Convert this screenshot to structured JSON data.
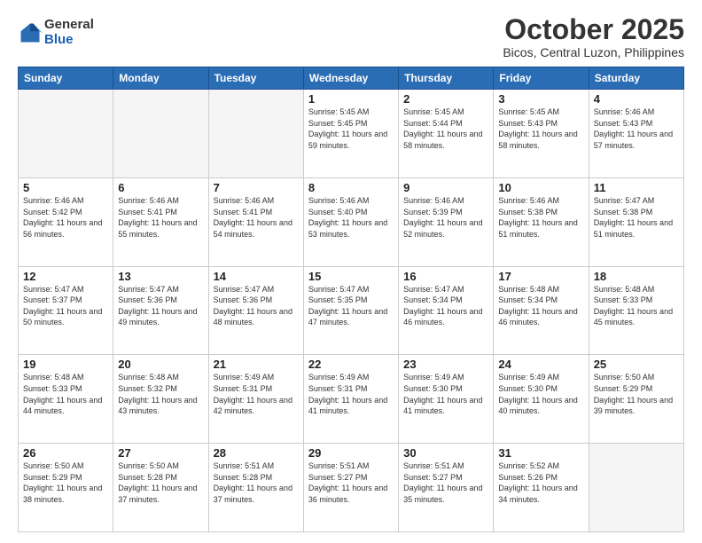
{
  "logo": {
    "general": "General",
    "blue": "Blue"
  },
  "header": {
    "month": "October 2025",
    "location": "Bicos, Central Luzon, Philippines"
  },
  "weekdays": [
    "Sunday",
    "Monday",
    "Tuesday",
    "Wednesday",
    "Thursday",
    "Friday",
    "Saturday"
  ],
  "weeks": [
    [
      {
        "day": "",
        "sunrise": "",
        "sunset": "",
        "daylight": "",
        "empty": true
      },
      {
        "day": "",
        "sunrise": "",
        "sunset": "",
        "daylight": "",
        "empty": true
      },
      {
        "day": "",
        "sunrise": "",
        "sunset": "",
        "daylight": "",
        "empty": true
      },
      {
        "day": "1",
        "sunrise": "Sunrise: 5:45 AM",
        "sunset": "Sunset: 5:45 PM",
        "daylight": "Daylight: 11 hours and 59 minutes."
      },
      {
        "day": "2",
        "sunrise": "Sunrise: 5:45 AM",
        "sunset": "Sunset: 5:44 PM",
        "daylight": "Daylight: 11 hours and 58 minutes."
      },
      {
        "day": "3",
        "sunrise": "Sunrise: 5:45 AM",
        "sunset": "Sunset: 5:43 PM",
        "daylight": "Daylight: 11 hours and 58 minutes."
      },
      {
        "day": "4",
        "sunrise": "Sunrise: 5:46 AM",
        "sunset": "Sunset: 5:43 PM",
        "daylight": "Daylight: 11 hours and 57 minutes."
      }
    ],
    [
      {
        "day": "5",
        "sunrise": "Sunrise: 5:46 AM",
        "sunset": "Sunset: 5:42 PM",
        "daylight": "Daylight: 11 hours and 56 minutes."
      },
      {
        "day": "6",
        "sunrise": "Sunrise: 5:46 AM",
        "sunset": "Sunset: 5:41 PM",
        "daylight": "Daylight: 11 hours and 55 minutes."
      },
      {
        "day": "7",
        "sunrise": "Sunrise: 5:46 AM",
        "sunset": "Sunset: 5:41 PM",
        "daylight": "Daylight: 11 hours and 54 minutes."
      },
      {
        "day": "8",
        "sunrise": "Sunrise: 5:46 AM",
        "sunset": "Sunset: 5:40 PM",
        "daylight": "Daylight: 11 hours and 53 minutes."
      },
      {
        "day": "9",
        "sunrise": "Sunrise: 5:46 AM",
        "sunset": "Sunset: 5:39 PM",
        "daylight": "Daylight: 11 hours and 52 minutes."
      },
      {
        "day": "10",
        "sunrise": "Sunrise: 5:46 AM",
        "sunset": "Sunset: 5:38 PM",
        "daylight": "Daylight: 11 hours and 51 minutes."
      },
      {
        "day": "11",
        "sunrise": "Sunrise: 5:47 AM",
        "sunset": "Sunset: 5:38 PM",
        "daylight": "Daylight: 11 hours and 51 minutes."
      }
    ],
    [
      {
        "day": "12",
        "sunrise": "Sunrise: 5:47 AM",
        "sunset": "Sunset: 5:37 PM",
        "daylight": "Daylight: 11 hours and 50 minutes."
      },
      {
        "day": "13",
        "sunrise": "Sunrise: 5:47 AM",
        "sunset": "Sunset: 5:36 PM",
        "daylight": "Daylight: 11 hours and 49 minutes."
      },
      {
        "day": "14",
        "sunrise": "Sunrise: 5:47 AM",
        "sunset": "Sunset: 5:36 PM",
        "daylight": "Daylight: 11 hours and 48 minutes."
      },
      {
        "day": "15",
        "sunrise": "Sunrise: 5:47 AM",
        "sunset": "Sunset: 5:35 PM",
        "daylight": "Daylight: 11 hours and 47 minutes."
      },
      {
        "day": "16",
        "sunrise": "Sunrise: 5:47 AM",
        "sunset": "Sunset: 5:34 PM",
        "daylight": "Daylight: 11 hours and 46 minutes."
      },
      {
        "day": "17",
        "sunrise": "Sunrise: 5:48 AM",
        "sunset": "Sunset: 5:34 PM",
        "daylight": "Daylight: 11 hours and 46 minutes."
      },
      {
        "day": "18",
        "sunrise": "Sunrise: 5:48 AM",
        "sunset": "Sunset: 5:33 PM",
        "daylight": "Daylight: 11 hours and 45 minutes."
      }
    ],
    [
      {
        "day": "19",
        "sunrise": "Sunrise: 5:48 AM",
        "sunset": "Sunset: 5:33 PM",
        "daylight": "Daylight: 11 hours and 44 minutes."
      },
      {
        "day": "20",
        "sunrise": "Sunrise: 5:48 AM",
        "sunset": "Sunset: 5:32 PM",
        "daylight": "Daylight: 11 hours and 43 minutes."
      },
      {
        "day": "21",
        "sunrise": "Sunrise: 5:49 AM",
        "sunset": "Sunset: 5:31 PM",
        "daylight": "Daylight: 11 hours and 42 minutes."
      },
      {
        "day": "22",
        "sunrise": "Sunrise: 5:49 AM",
        "sunset": "Sunset: 5:31 PM",
        "daylight": "Daylight: 11 hours and 41 minutes."
      },
      {
        "day": "23",
        "sunrise": "Sunrise: 5:49 AM",
        "sunset": "Sunset: 5:30 PM",
        "daylight": "Daylight: 11 hours and 41 minutes."
      },
      {
        "day": "24",
        "sunrise": "Sunrise: 5:49 AM",
        "sunset": "Sunset: 5:30 PM",
        "daylight": "Daylight: 11 hours and 40 minutes."
      },
      {
        "day": "25",
        "sunrise": "Sunrise: 5:50 AM",
        "sunset": "Sunset: 5:29 PM",
        "daylight": "Daylight: 11 hours and 39 minutes."
      }
    ],
    [
      {
        "day": "26",
        "sunrise": "Sunrise: 5:50 AM",
        "sunset": "Sunset: 5:29 PM",
        "daylight": "Daylight: 11 hours and 38 minutes."
      },
      {
        "day": "27",
        "sunrise": "Sunrise: 5:50 AM",
        "sunset": "Sunset: 5:28 PM",
        "daylight": "Daylight: 11 hours and 37 minutes."
      },
      {
        "day": "28",
        "sunrise": "Sunrise: 5:51 AM",
        "sunset": "Sunset: 5:28 PM",
        "daylight": "Daylight: 11 hours and 37 minutes."
      },
      {
        "day": "29",
        "sunrise": "Sunrise: 5:51 AM",
        "sunset": "Sunset: 5:27 PM",
        "daylight": "Daylight: 11 hours and 36 minutes."
      },
      {
        "day": "30",
        "sunrise": "Sunrise: 5:51 AM",
        "sunset": "Sunset: 5:27 PM",
        "daylight": "Daylight: 11 hours and 35 minutes."
      },
      {
        "day": "31",
        "sunrise": "Sunrise: 5:52 AM",
        "sunset": "Sunset: 5:26 PM",
        "daylight": "Daylight: 11 hours and 34 minutes."
      },
      {
        "day": "",
        "sunrise": "",
        "sunset": "",
        "daylight": "",
        "empty": true
      }
    ]
  ]
}
